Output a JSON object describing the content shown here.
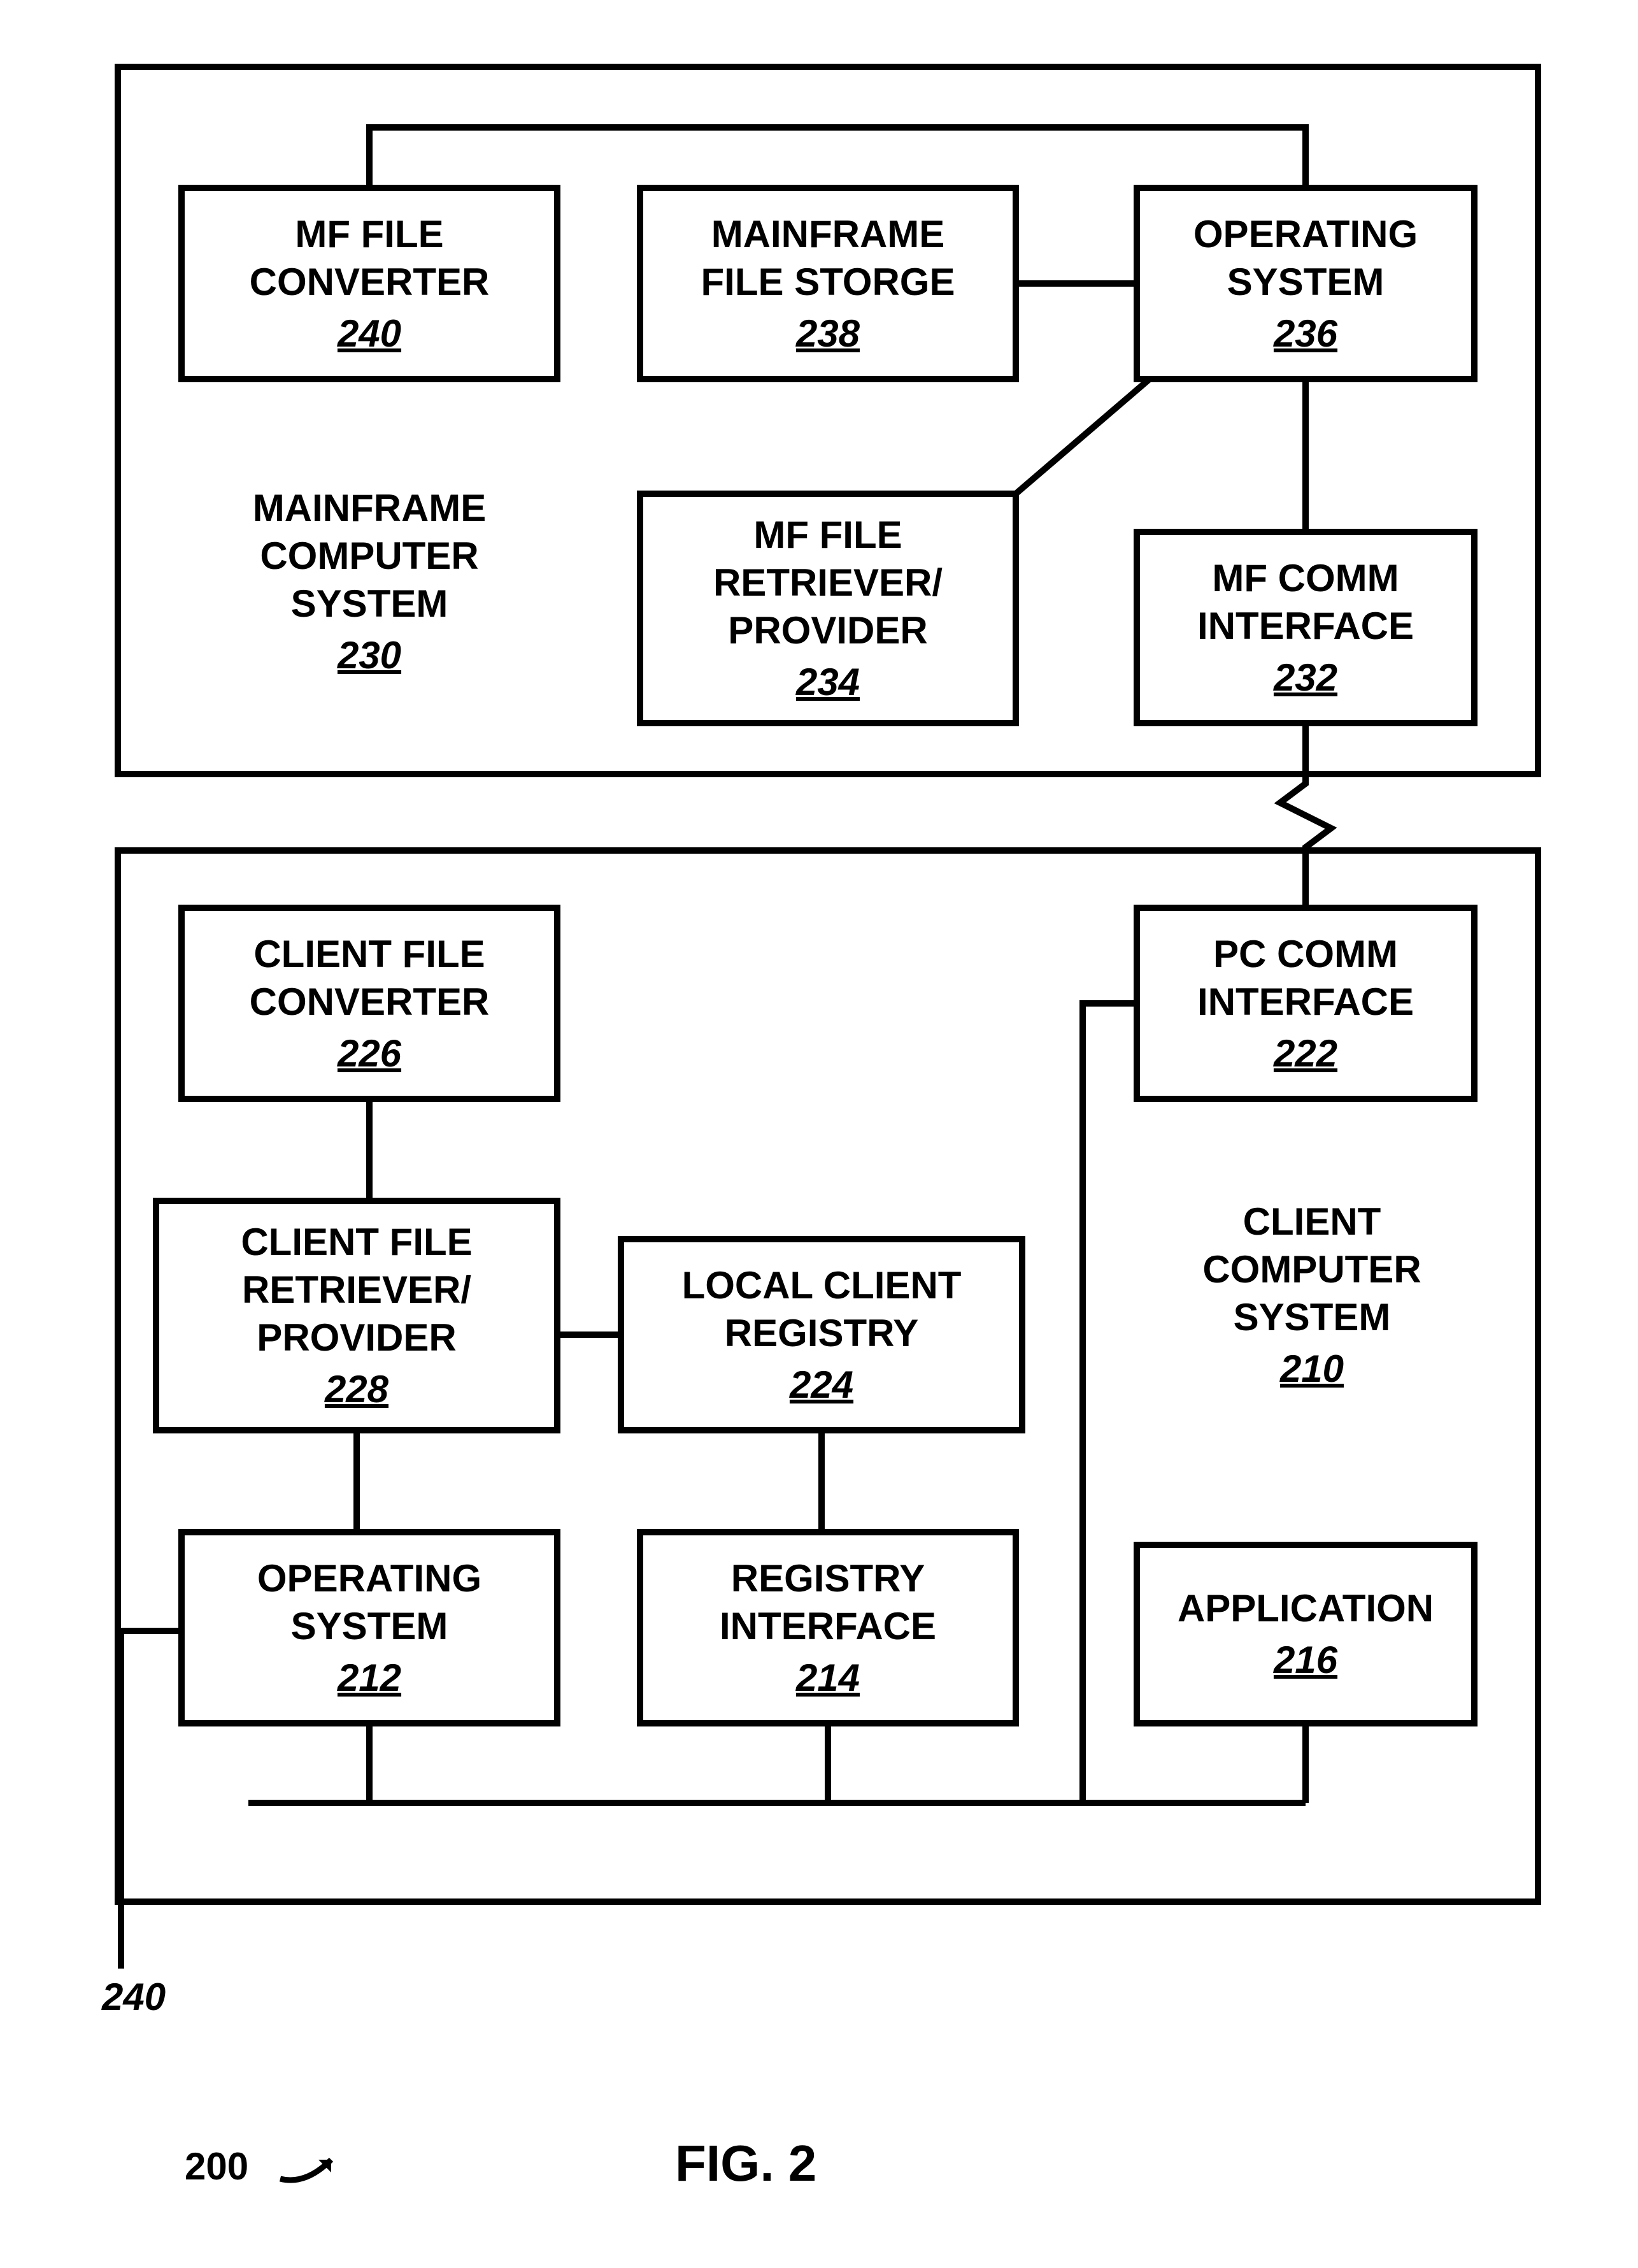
{
  "mainframe": {
    "label_l1": "MAINFRAME",
    "label_l2": "COMPUTER",
    "label_l3": "SYSTEM",
    "ref": "230",
    "blocks": {
      "converter": {
        "l1": "MF FILE",
        "l2": "CONVERTER",
        "ref": "240"
      },
      "storage": {
        "l1": "MAINFRAME",
        "l2": "FILE STORGE",
        "ref": "238"
      },
      "os": {
        "l1": "OPERATING",
        "l2": "SYSTEM",
        "ref": "236"
      },
      "retriever": {
        "l1": "MF FILE",
        "l2": "RETRIEVER/",
        "l3": "PROVIDER",
        "ref": "234"
      },
      "comm": {
        "l1": "MF COMM",
        "l2": "INTERFACE",
        "ref": "232"
      }
    }
  },
  "client": {
    "label_l1": "CLIENT",
    "label_l2": "COMPUTER",
    "label_l3": "SYSTEM",
    "ref": "210",
    "blocks": {
      "converter": {
        "l1": "CLIENT FILE",
        "l2": "CONVERTER",
        "ref": "226"
      },
      "pccomm": {
        "l1": "PC COMM",
        "l2": "INTERFACE",
        "ref": "222"
      },
      "retriever": {
        "l1": "CLIENT FILE",
        "l2": "RETRIEVER/",
        "l3": "PROVIDER",
        "ref": "228"
      },
      "registry": {
        "l1": "LOCAL CLIENT",
        "l2": "REGISTRY",
        "ref": "224"
      },
      "os": {
        "l1": "OPERATING",
        "l2": "SYSTEM",
        "ref": "212"
      },
      "regiface": {
        "l1": "REGISTRY",
        "l2": "INTERFACE",
        "ref": "214"
      },
      "app": {
        "l1": "APPLICATION",
        "ref": "216"
      }
    }
  },
  "callout_ref": "240",
  "figure_ref": "200",
  "figure_label": "FIG. 2"
}
